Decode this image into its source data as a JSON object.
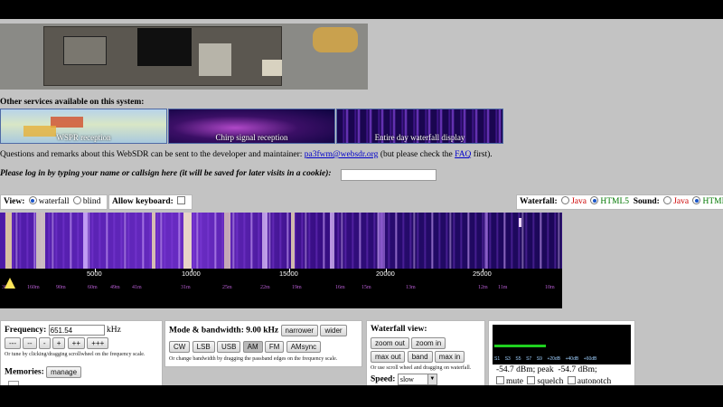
{
  "services": {
    "title": "Other services available on this system:",
    "items": [
      {
        "label": "WSPR reception"
      },
      {
        "label": "Chirp signal reception"
      },
      {
        "label": "Entire day waterfall display"
      }
    ]
  },
  "questions": {
    "prefix": "Questions and remarks about this WebSDR can be sent to the developer and maintainer: ",
    "email": "pa3fwm@websdr.org",
    "middle": " (but please check the ",
    "faq": "FAQ",
    "suffix": " first)."
  },
  "login": {
    "label": "Please log in by typing your name or callsign here (it will be saved for later visits in a cookie):",
    "value": ""
  },
  "view": {
    "label": "View:",
    "options": [
      "waterfall",
      "blind"
    ],
    "selected": "waterfall"
  },
  "keyboard": {
    "label": "Allow keyboard:"
  },
  "waterfall_opts": {
    "label": "Waterfall:",
    "java": "Java",
    "html5": "HTML5",
    "selected": "HTML5"
  },
  "sound_opts": {
    "label": "Sound:",
    "java": "Java",
    "html5": "HTML5",
    "selected": "HTML5"
  },
  "scale": {
    "ticks": [
      "5000",
      "10000",
      "15000",
      "20000",
      "25000"
    ],
    "stations": [
      "30m",
      "160m",
      "90m",
      "60m",
      "49m",
      "41m",
      "31m",
      "25m",
      "22m",
      "19m",
      "16m",
      "15m",
      "13m",
      "12m",
      "11m",
      "10m"
    ]
  },
  "frequency": {
    "label": "Frequency:",
    "value": "651.54",
    "unit": "kHz",
    "buttons": [
      "---",
      "--",
      "-",
      "+",
      "++",
      "+++"
    ],
    "hint": "Or tune by clicking/dragging scrollwheel on the frequency scale."
  },
  "memories": {
    "label": "Memories:",
    "button": "manage"
  },
  "mode": {
    "label": "Mode & bandwidth:",
    "bandwidth": "9.00 kHz",
    "narrower": "narrower",
    "wider": "wider",
    "modes": [
      "CW",
      "LSB",
      "USB",
      "AM",
      "FM",
      "AMsync"
    ],
    "active": "AM",
    "hint": "Or change bandwidth by dragging the passband edges on the frequency scale."
  },
  "wfview": {
    "label": "Waterfall view:",
    "buttons": [
      "zoom out",
      "zoom in",
      "max out",
      "band",
      "max in"
    ],
    "hint": "Or use scroll wheel and dragging on waterfall.",
    "speed_label": "Speed:",
    "speed_value": "slow"
  },
  "meter": {
    "scale": [
      "S1",
      "S3",
      "S5",
      "S7",
      "S9",
      "+20dB",
      "+40dB",
      "+60dB"
    ],
    "level_dbm": "-54.7 dBm;",
    "peak_label": "peak",
    "peak_dbm": "-54.7 dBm;",
    "level_fraction": 0.38,
    "mute": "mute",
    "squelch": "squelch",
    "autonotch": "autonotch"
  },
  "colors": {
    "accent": "#1a55c8",
    "link": "#0000cc",
    "meter_bar": "#1fd01f",
    "station_label": "#b85dd4"
  }
}
